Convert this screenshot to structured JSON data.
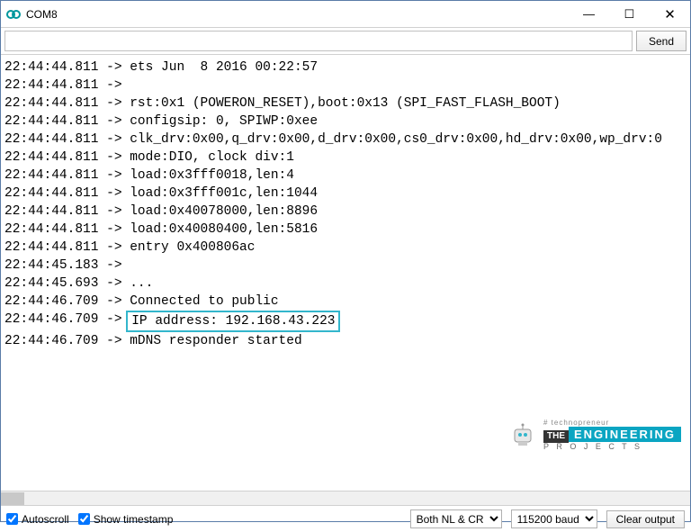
{
  "window": {
    "title": "COM8",
    "minimize": "—",
    "maximize": "☐",
    "close": "✕"
  },
  "input": {
    "value": "",
    "send_label": "Send"
  },
  "log_lines": [
    {
      "ts": "22:44:44.811",
      "msg": "ets Jun  8 2016 00:22:57"
    },
    {
      "ts": "22:44:44.811",
      "msg": ""
    },
    {
      "ts": "22:44:44.811",
      "msg": "rst:0x1 (POWERON_RESET),boot:0x13 (SPI_FAST_FLASH_BOOT)"
    },
    {
      "ts": "22:44:44.811",
      "msg": "configsip: 0, SPIWP:0xee"
    },
    {
      "ts": "22:44:44.811",
      "msg": "clk_drv:0x00,q_drv:0x00,d_drv:0x00,cs0_drv:0x00,hd_drv:0x00,wp_drv:0"
    },
    {
      "ts": "22:44:44.811",
      "msg": "mode:DIO, clock div:1"
    },
    {
      "ts": "22:44:44.811",
      "msg": "load:0x3fff0018,len:4"
    },
    {
      "ts": "22:44:44.811",
      "msg": "load:0x3fff001c,len:1044"
    },
    {
      "ts": "22:44:44.811",
      "msg": "load:0x40078000,len:8896"
    },
    {
      "ts": "22:44:44.811",
      "msg": "load:0x40080400,len:5816"
    },
    {
      "ts": "22:44:44.811",
      "msg": "entry 0x400806ac"
    },
    {
      "ts": "22:44:45.183",
      "msg": ""
    },
    {
      "ts": "22:44:45.693",
      "msg": "..."
    },
    {
      "ts": "22:44:46.709",
      "msg": "Connected to public"
    },
    {
      "ts": "22:44:46.709",
      "msg": "IP address: 192.168.43.223",
      "highlight": true
    },
    {
      "ts": "22:44:46.709",
      "msg": "mDNS responder started"
    }
  ],
  "bottom": {
    "autoscroll_label": "Autoscroll",
    "autoscroll_checked": true,
    "timestamp_label": "Show timestamp",
    "timestamp_checked": true,
    "line_ending": "Both NL & CR",
    "baud": "115200 baud",
    "clear_label": "Clear output"
  },
  "watermark": {
    "hash": "# technopreneur",
    "the": "THE",
    "eng": "ENGINEERING",
    "proj": "P R O J E C T S"
  }
}
